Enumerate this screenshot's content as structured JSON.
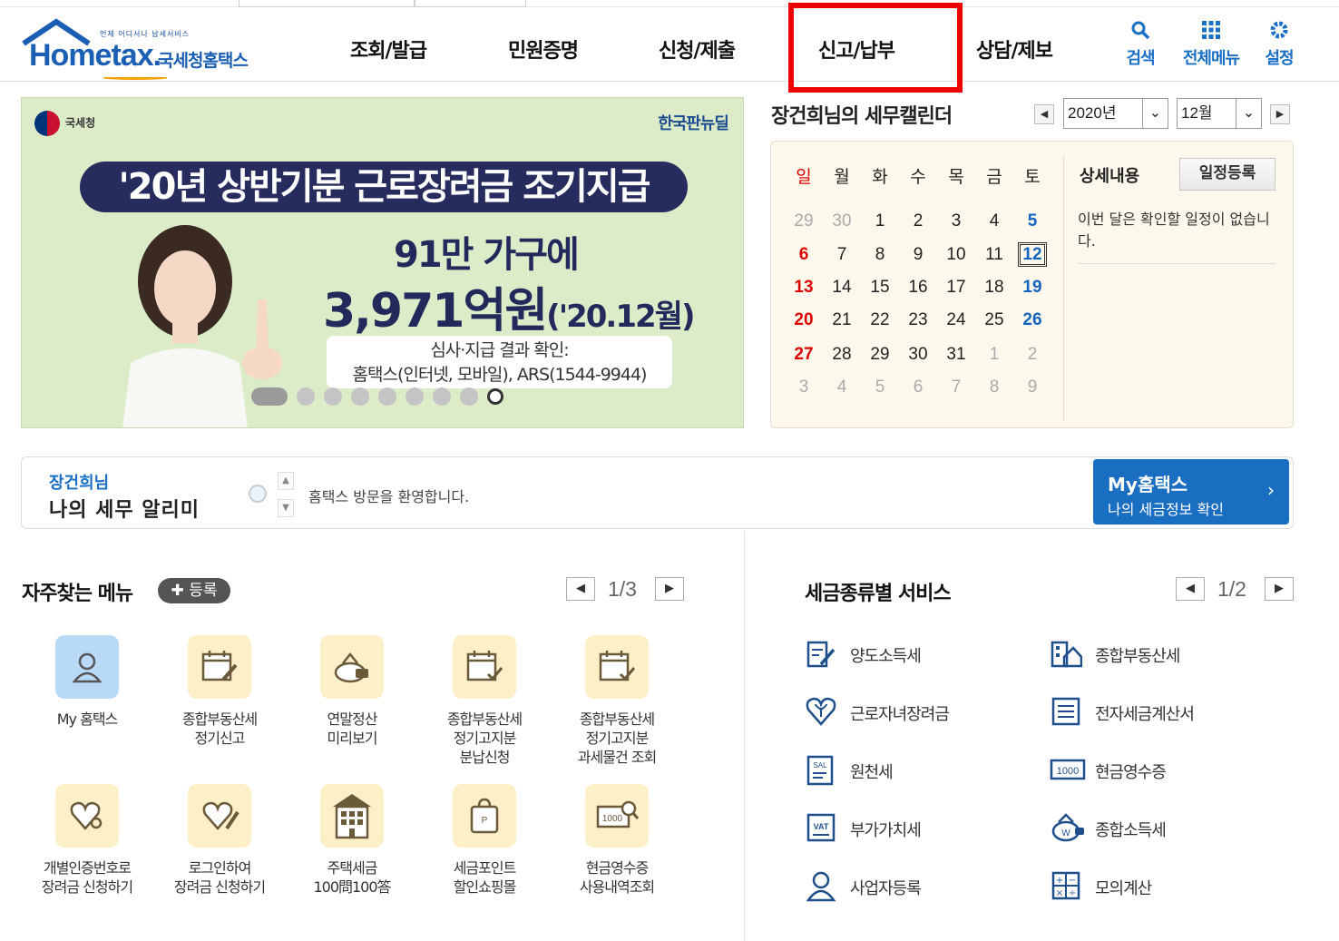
{
  "header": {
    "logo_small": "언제 어디서나 납세서비스",
    "logo_main": "Hometax.",
    "logo_kr": "국세청홈택스",
    "nav": [
      "조회/발급",
      "민원증명",
      "신청/제출",
      "신고/납부",
      "상담/제보"
    ],
    "utils": [
      {
        "label": "검색",
        "icon": "search-icon"
      },
      {
        "label": "전체메뉴",
        "icon": "grid-icon"
      },
      {
        "label": "설정",
        "icon": "gear-icon"
      }
    ]
  },
  "banner": {
    "agency": "국세청",
    "newdeal": "한국판뉴딜",
    "headline": "'20년 상반기분 근로장려금 조기지급",
    "line1": "91만 가구에",
    "line2": "3,971억원",
    "line2_sub": "('20.12월)",
    "info1": "심사·지급 결과 확인:",
    "info2": "홈택스(인터넷, 모바일), ARS(1544-9944)",
    "slides": 9
  },
  "calendar": {
    "title": "장건희님의 세무캘린더",
    "year": "2020년",
    "month": "12월",
    "weekdays": [
      "일",
      "월",
      "화",
      "수",
      "목",
      "금",
      "토"
    ],
    "weeks": [
      [
        "29",
        "30",
        "1",
        "2",
        "3",
        "4",
        "5"
      ],
      [
        "6",
        "7",
        "8",
        "9",
        "10",
        "11",
        "12"
      ],
      [
        "13",
        "14",
        "15",
        "16",
        "17",
        "18",
        "19"
      ],
      [
        "20",
        "21",
        "22",
        "23",
        "24",
        "25",
        "26"
      ],
      [
        "27",
        "28",
        "29",
        "30",
        "31",
        "1",
        "2"
      ],
      [
        "3",
        "4",
        "5",
        "6",
        "7",
        "8",
        "9"
      ]
    ],
    "today": "12",
    "detail_title": "상세내용",
    "schedule_button": "일정등록",
    "detail_text": "이번 달은 확인할 일정이 없습니다."
  },
  "alarm": {
    "user": "장건희님",
    "title": "나의 세무 알리미",
    "message": "홈택스 방문을 환영합니다.",
    "my_title": "My홈택스",
    "my_sub": "나의 세금정보 확인"
  },
  "favorites": {
    "title": "자주찾는 메뉴",
    "register": "등록",
    "page": "1/3",
    "items": [
      {
        "label": "My 홈택스",
        "icon": "person-icon"
      },
      {
        "label": "종합부동산세\n정기신고",
        "icon": "calendar-edit-icon"
      },
      {
        "label": "연말정산\n미리보기",
        "icon": "money-bag-icon"
      },
      {
        "label": "종합부동산세\n정기고지분\n분납신청",
        "icon": "calendar-check-icon"
      },
      {
        "label": "종합부동산세\n정기고지분\n과세물건 조회",
        "icon": "calendar-check-icon"
      },
      {
        "label": "개별인증번호로\n장려금 신청하기",
        "icon": "heart-key-icon"
      },
      {
        "label": "로그인하여\n장려금 신청하기",
        "icon": "heart-pen-icon"
      },
      {
        "label": "주택세금\n100問100答",
        "icon": "building-icon"
      },
      {
        "label": "세금포인트\n할인쇼핑몰",
        "icon": "shopping-bag-icon"
      },
      {
        "label": "현금영수증\n사용내역조회",
        "icon": "receipt-search-icon"
      }
    ]
  },
  "tax_services": {
    "title": "세금종류별 서비스",
    "page": "1/2",
    "items": [
      {
        "label": "양도소득세",
        "icon": "document-edit-icon"
      },
      {
        "label": "종합부동산세",
        "icon": "building-house-icon"
      },
      {
        "label": "근로자녀장려금",
        "icon": "heart-sprout-icon"
      },
      {
        "label": "전자세금계산서",
        "icon": "invoice-icon"
      },
      {
        "label": "원천세",
        "icon": "salary-doc-icon"
      },
      {
        "label": "현금영수증",
        "icon": "cash-1000-icon"
      },
      {
        "label": "부가가치세",
        "icon": "vat-icon"
      },
      {
        "label": "종합소득세",
        "icon": "money-bag-w-icon"
      },
      {
        "label": "사업자등록",
        "icon": "person-outline-icon"
      },
      {
        "label": "모의계산",
        "icon": "calculator-icon"
      }
    ]
  },
  "colors": {
    "brand_blue": "#1a6fc6",
    "highlight_red": "#ee0000",
    "banner_bg": "#dcecc8",
    "calendar_bg": "#fcf9ec"
  }
}
